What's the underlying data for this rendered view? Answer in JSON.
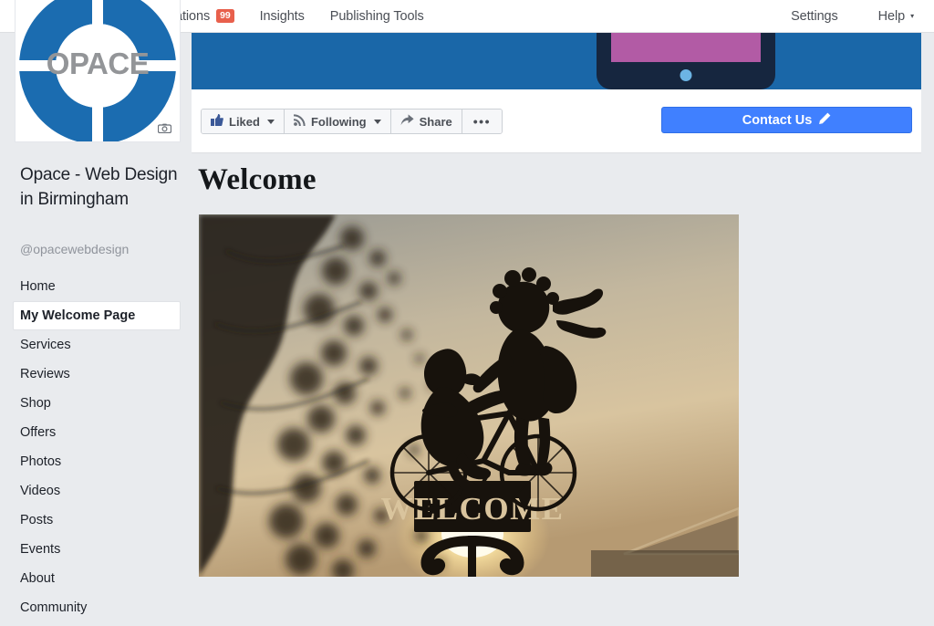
{
  "topnav": {
    "items": [
      {
        "label": "ations",
        "badge": "99"
      },
      {
        "label": "Insights",
        "badge": ""
      },
      {
        "label": "Publishing Tools",
        "badge": ""
      }
    ],
    "right_items": [
      {
        "label": "Settings",
        "caret": ""
      },
      {
        "label": "Help",
        "caret": "▾"
      }
    ]
  },
  "cover": {
    "background_color": "#1a67a8",
    "device_body_color": "#16263f",
    "device_screen_color": "#b25ba5",
    "device_home_color": "#6cb4e4"
  },
  "actionbar": {
    "liked_label": "Liked",
    "following_label": "Following",
    "share_label": "Share",
    "more_label": "•••",
    "contact_label": "Contact Us",
    "contact_color": "#4080ff"
  },
  "profile": {
    "logo_text": "OPACE",
    "logo_ring_color": "#1b6cb0",
    "logo_text_color": "#939598",
    "name": "Opace - Web Design in Birmingham",
    "handle": "@opacewebdesign"
  },
  "sidebar": {
    "items": [
      {
        "label": "Home",
        "active": false
      },
      {
        "label": "My Welcome Page",
        "active": true
      },
      {
        "label": "Services",
        "active": false
      },
      {
        "label": "Reviews",
        "active": false
      },
      {
        "label": "Shop",
        "active": false
      },
      {
        "label": "Offers",
        "active": false
      },
      {
        "label": "Photos",
        "active": false
      },
      {
        "label": "Videos",
        "active": false
      },
      {
        "label": "Posts",
        "active": false
      },
      {
        "label": "Events",
        "active": false
      },
      {
        "label": "About",
        "active": false
      },
      {
        "label": "Community",
        "active": false
      }
    ]
  },
  "main": {
    "heading": "Welcome",
    "photo_sign_text": "WELCOME",
    "photo_description": "Sunset silhouette of a metal garden sign showing two children on a bicycle above a WELCOME plaque, with a blurred blossoming tree at left and sun flare below"
  }
}
